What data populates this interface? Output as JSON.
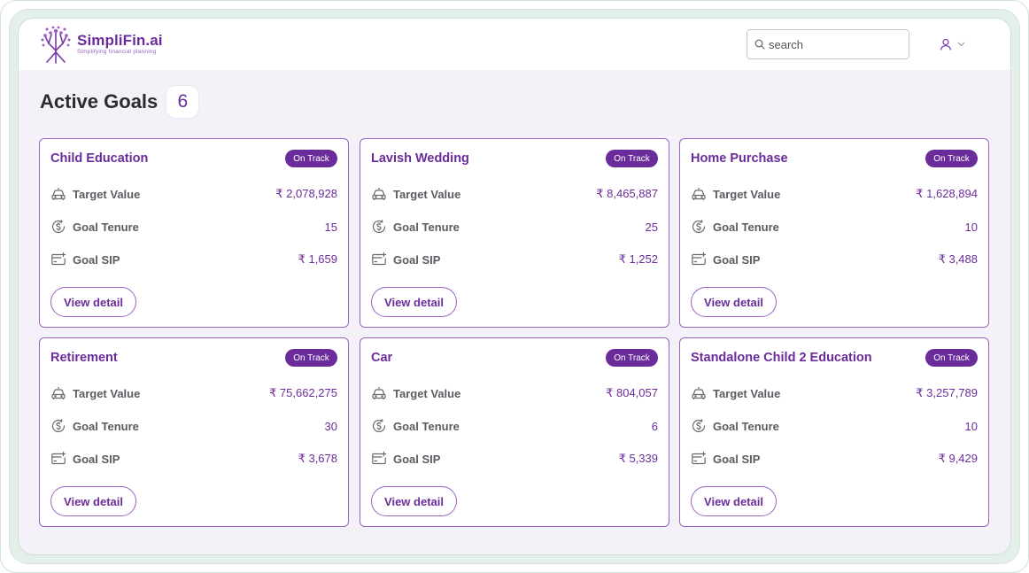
{
  "brand": {
    "name": "SimpliFin.ai",
    "tagline": "Simplifying financial planning"
  },
  "search": {
    "placeholder": "search",
    "value": ""
  },
  "header": {
    "title": "Active Goals",
    "count": "6"
  },
  "labels": {
    "target_value": "Target Value",
    "goal_tenure": "Goal Tenure",
    "goal_sip": "Goal SIP",
    "view_detail": "View detail"
  },
  "goals": [
    {
      "name": "Child Education",
      "status": "On Track",
      "target_value": "₹ 2,078,928",
      "tenure": "15",
      "sip": "₹ 1,659"
    },
    {
      "name": "Lavish Wedding",
      "status": "On Track",
      "target_value": "₹ 8,465,887",
      "tenure": "25",
      "sip": "₹ 1,252"
    },
    {
      "name": "Home Purchase",
      "status": "On Track",
      "target_value": "₹ 1,628,894",
      "tenure": "10",
      "sip": "₹ 3,488"
    },
    {
      "name": "Retirement",
      "status": "On Track",
      "target_value": "₹ 75,662,275",
      "tenure": "30",
      "sip": "₹ 3,678"
    },
    {
      "name": "Car",
      "status": "On Track",
      "target_value": "₹ 804,057",
      "tenure": "6",
      "sip": "₹ 5,339"
    },
    {
      "name": "Standalone Child 2 Education",
      "status": "On Track",
      "target_value": "₹ 3,257,789",
      "tenure": "10",
      "sip": "₹ 9,429"
    }
  ],
  "icons": {
    "logo": "tree-logo-icon",
    "search": "search-icon",
    "user": "user-icon",
    "dropdown": "chevron-down-icon",
    "target_value": "car-icon",
    "goal_tenure": "coin-cycle-icon",
    "goal_sip": "card-plus-icon"
  },
  "colors": {
    "accent": "#6a2c9a",
    "card_border": "#9b63c4",
    "page_bg": "#f5f1f8",
    "label_text": "#5d5a61"
  }
}
